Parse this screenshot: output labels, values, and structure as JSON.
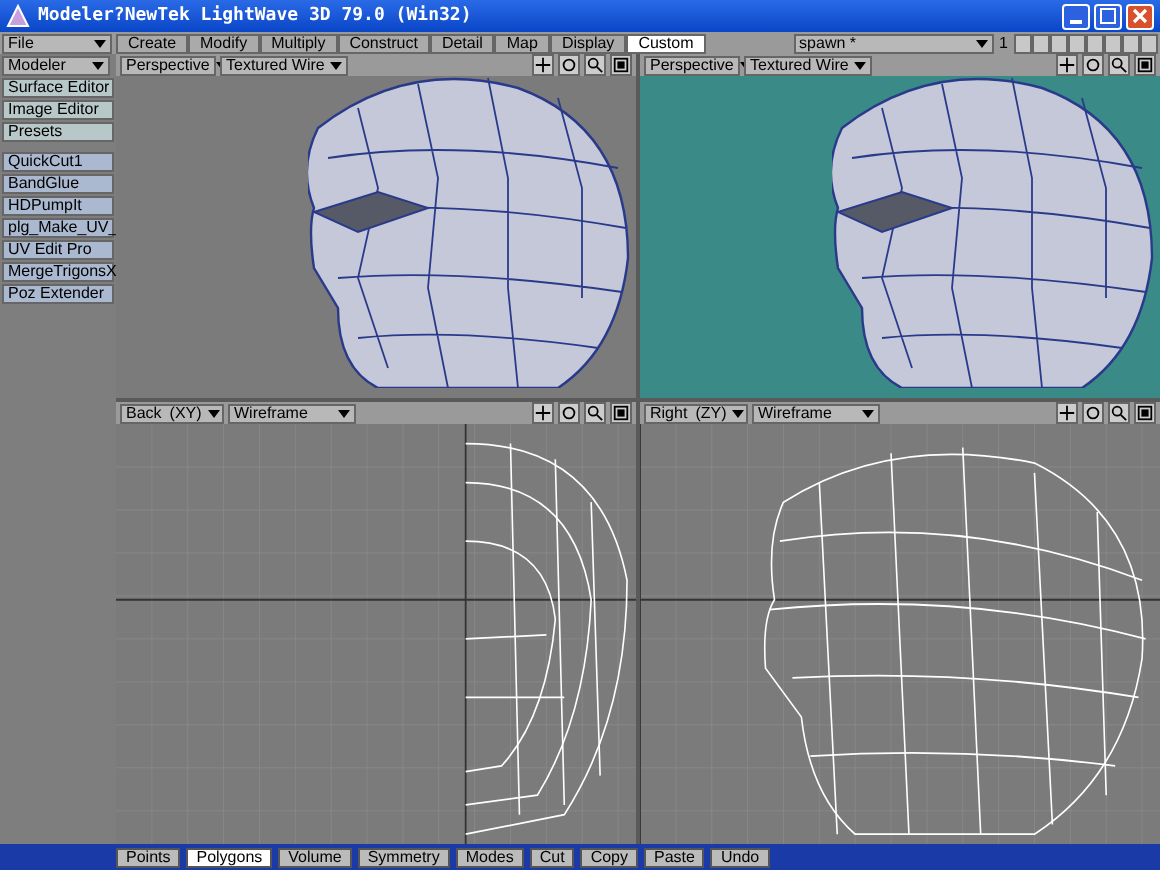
{
  "window": {
    "title": "Modeler?NewTek LightWave 3D 79.0 (Win32)"
  },
  "file_menu": "File",
  "tabs": [
    {
      "label": "Create",
      "selected": false
    },
    {
      "label": "Modify",
      "selected": false
    },
    {
      "label": "Multiply",
      "selected": false
    },
    {
      "label": "Construct",
      "selected": false
    },
    {
      "label": "Detail",
      "selected": false
    },
    {
      "label": "Map",
      "selected": false
    },
    {
      "label": "Display",
      "selected": false
    },
    {
      "label": "Custom",
      "selected": true
    }
  ],
  "layer_select": "spawn *",
  "layer_number": "1",
  "sidebar": {
    "menu": "Modeler",
    "items": [
      {
        "label": "Surface Editor",
        "kind": "editor"
      },
      {
        "label": "Image Editor",
        "kind": "editor"
      },
      {
        "label": "Presets",
        "kind": "editor"
      },
      {
        "label": "QuickCut1",
        "kind": "plugin"
      },
      {
        "label": "BandGlue",
        "kind": "plugin"
      },
      {
        "label": "HDPumpIt",
        "kind": "plugin"
      },
      {
        "label": "plg_Make_UV_",
        "kind": "plugin"
      },
      {
        "label": "UV Edit Pro",
        "kind": "plugin"
      },
      {
        "label": "MergeTrigonsX",
        "kind": "plugin"
      },
      {
        "label": "Poz Extender",
        "kind": "plugin"
      }
    ]
  },
  "viewports": [
    {
      "view": "Perspective",
      "mode": "Textured Wire",
      "active": false,
      "kind": "shaded"
    },
    {
      "view": "Perspective",
      "mode": "Textured Wire",
      "active": true,
      "kind": "shaded"
    },
    {
      "view": "Back",
      "axis": "(XY)",
      "mode": "Wireframe",
      "active": false,
      "kind": "front"
    },
    {
      "view": "Right",
      "axis": "(ZY)",
      "mode": "Wireframe",
      "active": false,
      "kind": "side"
    }
  ],
  "status_bar": {
    "buttons": [
      {
        "label": "Points",
        "selected": false
      },
      {
        "label": "Polygons",
        "selected": true
      },
      {
        "label": "Volume",
        "selected": false
      },
      {
        "label": "Symmetry",
        "selected": false
      },
      {
        "label": "Modes",
        "selected": false
      },
      {
        "label": "Cut",
        "selected": false
      },
      {
        "label": "Copy",
        "selected": false
      },
      {
        "label": "Paste",
        "selected": false
      },
      {
        "label": "Undo",
        "selected": false
      }
    ]
  }
}
